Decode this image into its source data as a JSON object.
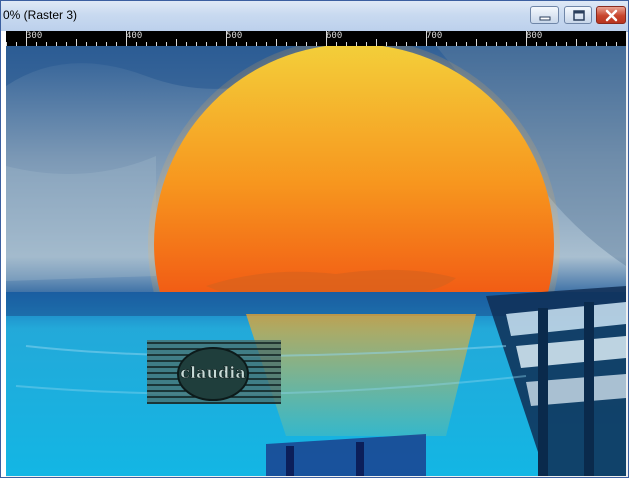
{
  "window": {
    "title": "0% (Raster 3)",
    "controls": {
      "minimize_icon": "minimize-icon",
      "maximize_icon": "maximize-icon",
      "close_icon": "close-icon"
    }
  },
  "ruler": {
    "labels": [
      "300",
      "400",
      "500",
      "600",
      "700",
      "800"
    ]
  },
  "image": {
    "watermark_text": "claudia"
  },
  "colors": {
    "titlebar": "#c9daf0",
    "close_button": "#c8452d",
    "sky": "#3a6fa8",
    "sea": "#19b7e0",
    "sun_top": "#f0c22a",
    "sun_bottom": "#ee3c12"
  }
}
